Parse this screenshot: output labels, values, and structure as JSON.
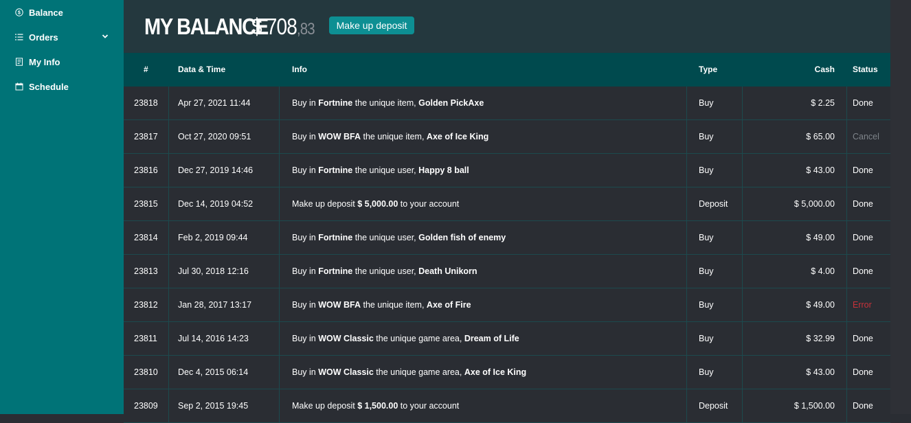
{
  "sidebar": {
    "items": [
      {
        "label": "Balance",
        "icon": "dollar-circle-icon"
      },
      {
        "label": "Orders",
        "icon": "list-icon",
        "has_dropdown": true
      },
      {
        "label": "My Info",
        "icon": "id-card-icon"
      },
      {
        "label": "Schedule",
        "icon": "calendar-icon"
      }
    ]
  },
  "header": {
    "title": "MY BALANCE",
    "amount_main": "$ 708",
    "amount_cents": ",83",
    "deposit_button": "Make up deposit"
  },
  "table": {
    "columns": [
      "#",
      "Data & Time",
      "Info",
      "Type",
      "Cash",
      "Status"
    ],
    "rows": [
      {
        "id": "23818",
        "datetime": "Apr 27, 2021 11:44",
        "info": [
          {
            "t": "Buy in "
          },
          {
            "t": "Fortnine",
            "b": true
          },
          {
            "t": " the unique item, "
          },
          {
            "t": "Golden PickAxe",
            "b": true
          }
        ],
        "type": "Buy",
        "cash": "$ 2.25",
        "status": "Done"
      },
      {
        "id": "23817",
        "datetime": "Oct 27, 2020 09:51",
        "info": [
          {
            "t": "Buy in "
          },
          {
            "t": "WOW BFA",
            "b": true
          },
          {
            "t": " the unique item, "
          },
          {
            "t": "Axe of Ice King",
            "b": true
          }
        ],
        "type": "Buy",
        "cash": "$ 65.00",
        "status": "Cancel"
      },
      {
        "id": "23816",
        "datetime": "Dec 27, 2019 14:46",
        "info": [
          {
            "t": "Buy in "
          },
          {
            "t": "Fortnine",
            "b": true
          },
          {
            "t": " the unique user, "
          },
          {
            "t": "Happy 8 ball",
            "b": true
          }
        ],
        "type": "Buy",
        "cash": "$ 43.00",
        "status": "Done"
      },
      {
        "id": "23815",
        "datetime": "Dec 14, 2019 04:52",
        "info": [
          {
            "t": "Make up deposit "
          },
          {
            "t": "$ 5,000.00",
            "b": true
          },
          {
            "t": " to your account"
          }
        ],
        "type": "Deposit",
        "cash": "$ 5,000.00",
        "status": "Done"
      },
      {
        "id": "23814",
        "datetime": "Feb 2, 2019 09:44",
        "info": [
          {
            "t": "Buy in "
          },
          {
            "t": "Fortnine",
            "b": true
          },
          {
            "t": " the unique user, "
          },
          {
            "t": "Golden fish of enemy",
            "b": true
          }
        ],
        "type": "Buy",
        "cash": "$ 49.00",
        "status": "Done"
      },
      {
        "id": "23813",
        "datetime": "Jul 30, 2018 12:16",
        "info": [
          {
            "t": "Buy in "
          },
          {
            "t": "Fortnine",
            "b": true
          },
          {
            "t": " the unique user, "
          },
          {
            "t": "Death Unikorn",
            "b": true
          }
        ],
        "type": "Buy",
        "cash": "$ 4.00",
        "status": "Done"
      },
      {
        "id": "23812",
        "datetime": "Jan 28, 2017 13:17",
        "info": [
          {
            "t": "Buy in "
          },
          {
            "t": "WOW BFA",
            "b": true
          },
          {
            "t": " the unique item, "
          },
          {
            "t": "Axe of Fire",
            "b": true
          }
        ],
        "type": "Buy",
        "cash": "$ 49.00",
        "status": "Error"
      },
      {
        "id": "23811",
        "datetime": "Jul 14, 2016 14:23",
        "info": [
          {
            "t": "Buy in "
          },
          {
            "t": "WOW Classic",
            "b": true
          },
          {
            "t": " the unique game area, "
          },
          {
            "t": "Dream of Life",
            "b": true
          }
        ],
        "type": "Buy",
        "cash": "$ 32.99",
        "status": "Done"
      },
      {
        "id": "23810",
        "datetime": "Dec 4, 2015 06:14",
        "info": [
          {
            "t": "Buy in "
          },
          {
            "t": "WOW Classic",
            "b": true
          },
          {
            "t": " the unique game area, "
          },
          {
            "t": "Axe of Ice King",
            "b": true
          }
        ],
        "type": "Buy",
        "cash": "$ 43.00",
        "status": "Done"
      },
      {
        "id": "23809",
        "datetime": "Sep 2, 2015 19:45",
        "info": [
          {
            "t": "Make up deposit "
          },
          {
            "t": "$ 1,500.00",
            "b": true
          },
          {
            "t": " to your account"
          }
        ],
        "type": "Deposit",
        "cash": "$ 1,500.00",
        "status": "Done"
      }
    ]
  },
  "colors": {
    "sidebar_bg": "#007377",
    "header_bg": "#24383e",
    "table_head_bg": "#004a4e",
    "body_bg": "#2a2d33",
    "accent_button": "#0d8f93",
    "status_cancel": "#7e848a",
    "status_error": "#c8323a"
  }
}
